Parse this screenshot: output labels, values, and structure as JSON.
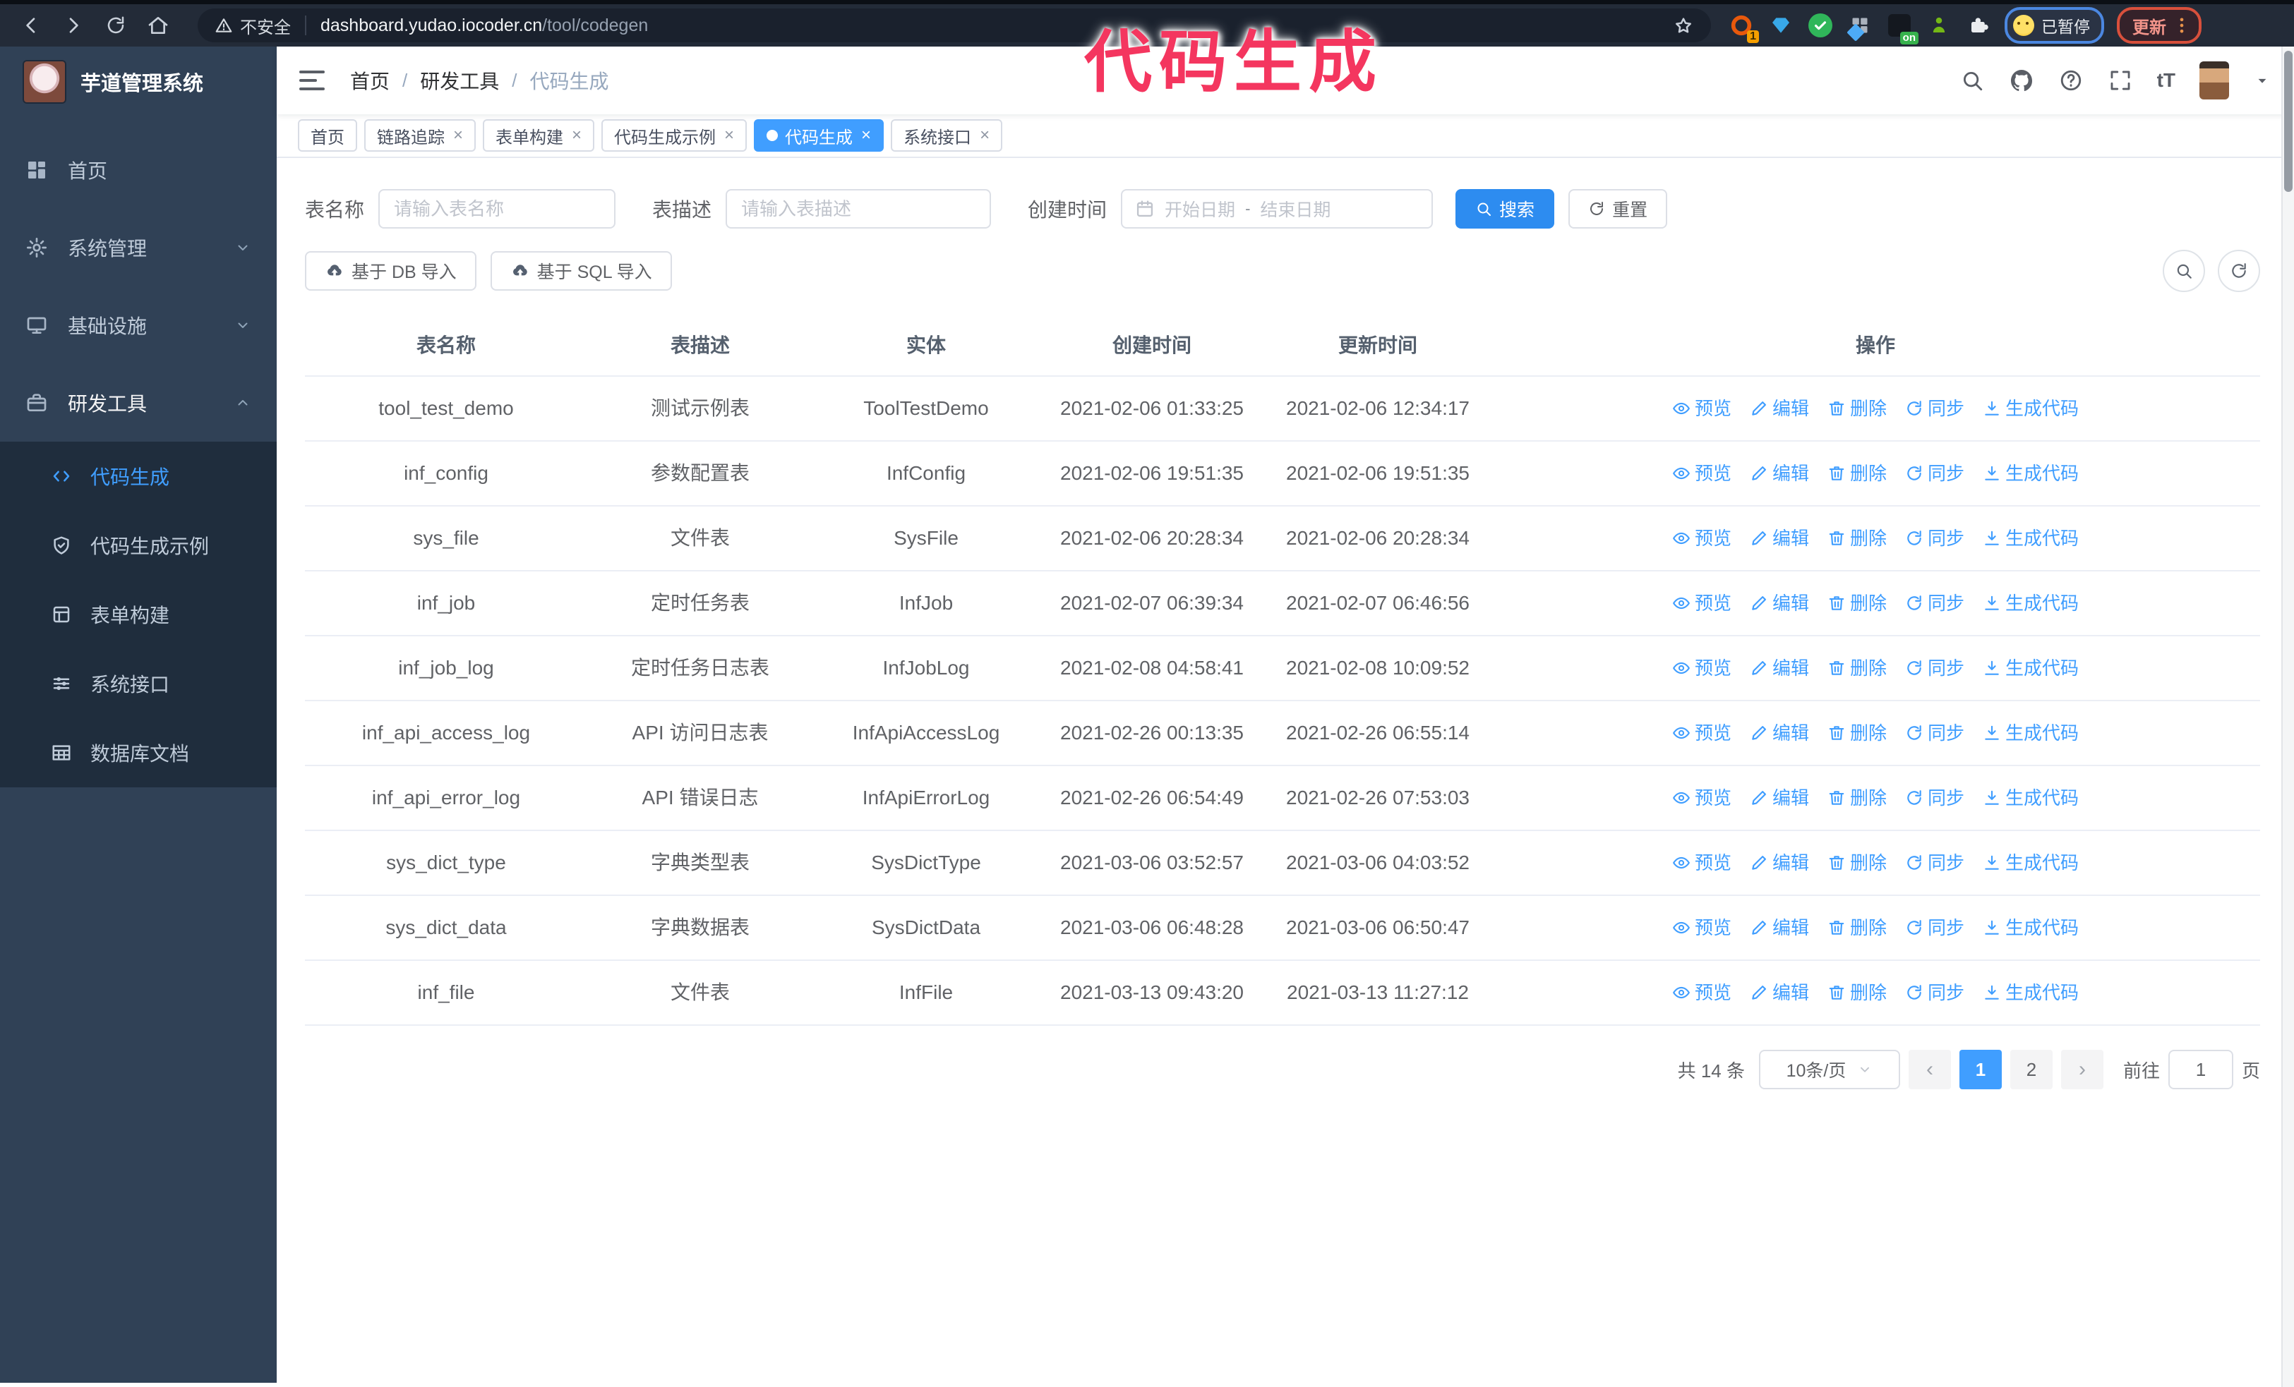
{
  "colors": {
    "accent": "#409eff",
    "primary_button": "#2d8cf0",
    "annotation": "#f4365f",
    "sidebar_bg": "#304156",
    "submenu_bg": "#1f2d3d"
  },
  "annotation": {
    "text": "代码生成"
  },
  "browser": {
    "security_label": "不安全",
    "url_host": "dashboard.yudao.iocoder.cn",
    "url_path": "/tool/codegen",
    "ext_badge_count": "1",
    "ext_badge_on": "on",
    "profile_badge": "已暂停",
    "update_button": "更新"
  },
  "sidebar": {
    "app_title": "芋道管理系统",
    "items": [
      {
        "id": "home",
        "label": "首页",
        "icon": "dashboard",
        "expandable": false,
        "open": false
      },
      {
        "id": "system",
        "label": "系统管理",
        "icon": "gear",
        "expandable": true,
        "open": false
      },
      {
        "id": "infra",
        "label": "基础设施",
        "icon": "monitor",
        "expandable": true,
        "open": false
      },
      {
        "id": "devtools",
        "label": "研发工具",
        "icon": "toolbox",
        "expandable": true,
        "open": true
      }
    ],
    "submenu": [
      {
        "id": "codegen",
        "label": "代码生成",
        "icon": "code",
        "active": true
      },
      {
        "id": "codegen-example",
        "label": "代码生成示例",
        "icon": "shield",
        "active": false
      },
      {
        "id": "form-builder",
        "label": "表单构建",
        "icon": "form",
        "active": false
      },
      {
        "id": "system-api",
        "label": "系统接口",
        "icon": "sliders",
        "active": false
      },
      {
        "id": "db-doc",
        "label": "数据库文档",
        "icon": "dbtable",
        "active": false
      }
    ]
  },
  "navbar": {
    "breadcrumb": [
      "首页",
      "研发工具",
      "代码生成"
    ]
  },
  "tabs": [
    {
      "label": "首页",
      "closable": false,
      "active": false
    },
    {
      "label": "链路追踪",
      "closable": true,
      "active": false
    },
    {
      "label": "表单构建",
      "closable": true,
      "active": false
    },
    {
      "label": "代码生成示例",
      "closable": true,
      "active": false
    },
    {
      "label": "代码生成",
      "closable": true,
      "active": true
    },
    {
      "label": "系统接口",
      "closable": true,
      "active": false
    }
  ],
  "filters": {
    "name_label": "表名称",
    "name_placeholder": "请输入表名称",
    "desc_label": "表描述",
    "desc_placeholder": "请输入表描述",
    "time_label": "创建时间",
    "start_placeholder": "开始日期",
    "range_separator": "-",
    "end_placeholder": "结束日期",
    "search_label": "搜索",
    "reset_label": "重置"
  },
  "toolbar": {
    "db_import_label": "基于 DB 导入",
    "sql_import_label": "基于 SQL 导入"
  },
  "table": {
    "columns": [
      "表名称",
      "表描述",
      "实体",
      "创建时间",
      "更新时间",
      "操作"
    ],
    "operations": [
      {
        "id": "preview",
        "label": "预览",
        "icon": "eye"
      },
      {
        "id": "edit",
        "label": "编辑",
        "icon": "edit"
      },
      {
        "id": "delete",
        "label": "删除",
        "icon": "trash"
      },
      {
        "id": "sync",
        "label": "同步",
        "icon": "sync"
      },
      {
        "id": "generate",
        "label": "生成代码",
        "icon": "download"
      }
    ],
    "rows": [
      {
        "name": "tool_test_demo",
        "desc": "测试示例表",
        "entity": "ToolTestDemo",
        "create_time": "2021-02-06 01:33:25",
        "update_time": "2021-02-06 12:34:17"
      },
      {
        "name": "inf_config",
        "desc": "参数配置表",
        "entity": "InfConfig",
        "create_time": "2021-02-06 19:51:35",
        "update_time": "2021-02-06 19:51:35"
      },
      {
        "name": "sys_file",
        "desc": "文件表",
        "entity": "SysFile",
        "create_time": "2021-02-06 20:28:34",
        "update_time": "2021-02-06 20:28:34"
      },
      {
        "name": "inf_job",
        "desc": "定时任务表",
        "entity": "InfJob",
        "create_time": "2021-02-07 06:39:34",
        "update_time": "2021-02-07 06:46:56"
      },
      {
        "name": "inf_job_log",
        "desc": "定时任务日志表",
        "entity": "InfJobLog",
        "create_time": "2021-02-08 04:58:41",
        "update_time": "2021-02-08 10:09:52"
      },
      {
        "name": "inf_api_access_log",
        "desc": "API 访问日志表",
        "entity": "InfApiAccessLog",
        "create_time": "2021-02-26 00:13:35",
        "update_time": "2021-02-26 06:55:14"
      },
      {
        "name": "inf_api_error_log",
        "desc": "API 错误日志",
        "entity": "InfApiErrorLog",
        "create_time": "2021-02-26 06:54:49",
        "update_time": "2021-02-26 07:53:03"
      },
      {
        "name": "sys_dict_type",
        "desc": "字典类型表",
        "entity": "SysDictType",
        "create_time": "2021-03-06 03:52:57",
        "update_time": "2021-03-06 04:03:52"
      },
      {
        "name": "sys_dict_data",
        "desc": "字典数据表",
        "entity": "SysDictData",
        "create_time": "2021-03-06 06:48:28",
        "update_time": "2021-03-06 06:50:47"
      },
      {
        "name": "inf_file",
        "desc": "文件表",
        "entity": "InfFile",
        "create_time": "2021-03-13 09:43:20",
        "update_time": "2021-03-13 11:27:12"
      }
    ]
  },
  "pagination": {
    "total_label": "共 14 条",
    "page_size_label": "10条/页",
    "pages": [
      "1",
      "2"
    ],
    "active_page": "1",
    "goto_label": "前往",
    "goto_value": "1",
    "page_unit": "页"
  }
}
